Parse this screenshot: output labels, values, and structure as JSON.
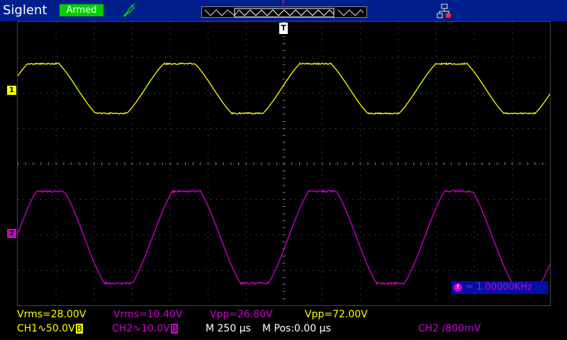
{
  "header": {
    "brand": "Siglent",
    "status": "Armed",
    "trigger_marker": "T"
  },
  "screen": {
    "trigger_label": "T",
    "ch1_label": "1",
    "ch2_label": "2",
    "frequency": {
      "icon": "f",
      "text": "= 1.00000KHz"
    }
  },
  "measurements": {
    "ch1_vrms": "Vrms=28.00V",
    "ch2_vrms": "Vrms=10.40V",
    "ch1_vpp": "Vpp=26.80V",
    "ch2_vpp": "Vpp=72.00V"
  },
  "status_bar": {
    "ch1_scale": "CH1∿50.0V",
    "ch1_bw": "B",
    "ch2_scale": "CH2∿10.0V",
    "ch2_bw": "B",
    "timebase": "M 250 µs",
    "mpos": "M Pos:0.00 µs",
    "trigger": "CH2 /800mV"
  },
  "colors": {
    "ch1": "#ffff00",
    "ch2": "#d000d0",
    "topbar": "#001f8c",
    "armed": "#00d000"
  },
  "icons": {
    "probe": "probe-icon",
    "usb": "network-icon"
  }
}
